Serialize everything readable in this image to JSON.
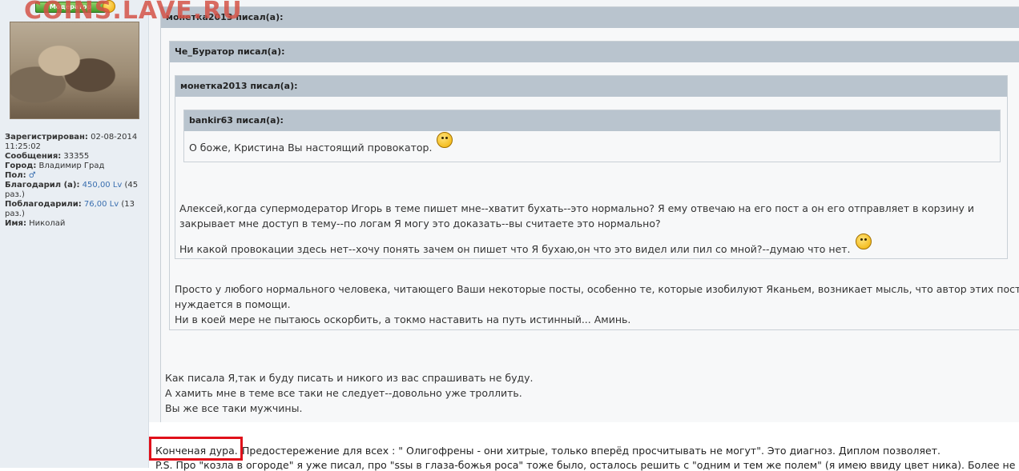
{
  "watermark": "COINS.LAVE.RU",
  "profile": {
    "rank_label": "Модератор",
    "registered_label": "Зарегистрирован:",
    "registered_value": "02-08-2014 11:25:02",
    "messages_label": "Сообщения:",
    "messages_value": "33355",
    "city_label": "Город:",
    "city_value": "Владимир Град",
    "gender_label": "Пол:",
    "gender_value": "♂",
    "thanked_label": "Благодарил (а):",
    "thanked_amount": "450,00 Lv",
    "thanked_times": "(45 раз.)",
    "got_thanks_label": "Поблагодарили:",
    "got_thanks_amount": "76,00 Lv",
    "got_thanks_times": "(13 раз.)",
    "name_label": "Имя:",
    "name_value": "Николай"
  },
  "quotes": {
    "q1_header": "монетка2013 писал(а):",
    "q2_header": "Че_Буратор писал(а):",
    "q3_header": "монетка2013 писал(а):",
    "q4_header": "bankir63 писал(а):",
    "q4_text": "О боже, Кристина Вы настоящий провокатор.",
    "q3_text_1": "Алексей,когда супермодератор Игорь в теме пишет мне--хватит бухать--это нормально? Я ему отвечаю на его пост а он его отправляет в корзину и",
    "q3_text_2": "закрывает мне доступ в тему--по логам Я могу это доказать--вы считаете это нормально?",
    "q3_text_3": "Ни какой провокации здесь нет--хочу понять зачем он пишет что Я бухаю,он что это видел или пил со мной?--думаю что нет.",
    "q2_text_1": "Просто у любого нормального человека, читающего Ваши некоторые посты, особенно те, которые изобилуют Яканьем, возникает мысль, что автор этих постов",
    "q2_text_2": "нуждается в помощи.",
    "q2_text_3": "Ни в коей мере не пытаюсь оскорбить, а токмо наставить на путь истинный... Аминь.",
    "q1_text_1": "Как писала Я,так и буду писать и никого из вас спрашивать не буду.",
    "q1_text_2": "А хамить мне в теме все таки не следует--довольно уже троллить.",
    "q1_text_3": "Вы же все таки мужчины."
  },
  "reply": {
    "highlighted": "Конченая дура.",
    "line1_rest": "Предостережение для всех : \" Олигофрены - они хитрые, только вперёд просчитывать не могут\". Это диагноз. Диплом позволяет.",
    "line2": "P.S. Про \"козла в огороде\" я уже писал, про \"ssы в глаза-божья роса\" тоже было, осталось решить с \"одним и тем же полем\" (я имею ввиду цвет ника). Более не"
  }
}
